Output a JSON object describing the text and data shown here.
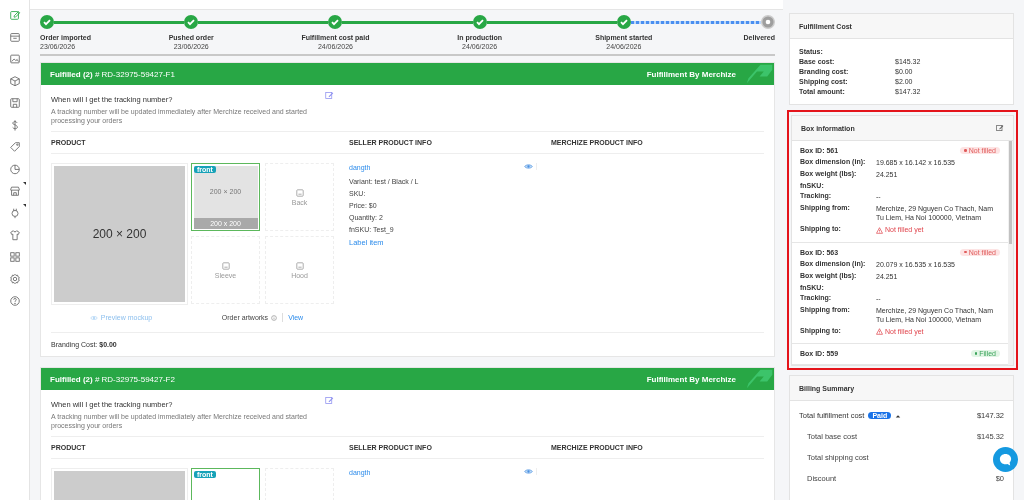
{
  "sidebar": {
    "items": [
      {
        "selected": true,
        "expandable": false
      },
      {
        "selected": false,
        "expandable": false
      },
      {
        "selected": false,
        "expandable": false
      },
      {
        "selected": false,
        "expandable": false
      },
      {
        "selected": false,
        "expandable": false
      },
      {
        "selected": false,
        "expandable": false
      },
      {
        "selected": false,
        "expandable": false
      },
      {
        "selected": false,
        "expandable": false
      },
      {
        "selected": false,
        "expandable": true
      },
      {
        "selected": false,
        "expandable": true
      },
      {
        "selected": false,
        "expandable": false
      },
      {
        "selected": false,
        "expandable": false
      },
      {
        "selected": false,
        "expandable": false
      },
      {
        "selected": false,
        "expandable": false
      }
    ]
  },
  "progress": {
    "steps": [
      {
        "label": "Order imported",
        "date": "23/06/2026",
        "done": true
      },
      {
        "label": "Pushed order",
        "date": "23/06/2026",
        "done": true
      },
      {
        "label": "Fulfillment cost paid",
        "date": "24/06/2026",
        "done": true
      },
      {
        "label": "In production",
        "date": "24/06/2026",
        "done": true
      },
      {
        "label": "Shipment started",
        "date": "24/06/2026",
        "done": true
      },
      {
        "label": "Delivered",
        "done": false
      }
    ]
  },
  "orders": [
    {
      "status": "Fulfilled (2)",
      "code": "# RD-32975-59427-F1",
      "fulfiller": "Fulfillment By Merchize",
      "tracking_question": "When will I get the tracking number?",
      "tracking_note": "A tracking number will be updated immediately after Merchize received and started processing your orders",
      "columns": [
        "PRODUCT",
        "SELLER PRODUCT INFO",
        "MERCHIZE PRODUCT INFO"
      ],
      "mockup": "200 × 200",
      "artworks": [
        {
          "badge": "front",
          "image": "200 × 200",
          "caption": "200 x 200",
          "selected": true
        },
        {
          "label": "Back",
          "selected": false
        },
        {
          "label": "Sleeve",
          "selected": false
        },
        {
          "label": "Hood",
          "selected": false
        }
      ],
      "preview": "Preview mockup",
      "artworks_label": "Order artworks",
      "view": "View",
      "seller": {
        "name": "dangth",
        "details": [
          "Variant: test / Black / L",
          "SKU:",
          "Price: $0",
          "Quantity: 2",
          "fnSKU: Test_9"
        ],
        "label_link": "Label item"
      },
      "branding_label": "Branding Cost:",
      "branding_value": "$0.00"
    },
    {
      "status": "Fulfilled (2)",
      "code": "# RD-32975-59427-F2",
      "fulfiller": "Fulfillment By Merchize",
      "tracking_question": "When will I get the tracking number?",
      "tracking_note": "A tracking number will be updated immediately after Merchize received and started processing your orders",
      "columns": [
        "PRODUCT",
        "SELLER PRODUCT INFO",
        "MERCHIZE PRODUCT INFO"
      ],
      "artworks": [
        {
          "badge": "front",
          "selected": true
        },
        {
          "selected": false
        }
      ],
      "seller": {
        "name": "dangth"
      }
    }
  ],
  "fulfillment_cost": {
    "title": "Fulfillment Cost",
    "rows": [
      {
        "label": "Status:"
      },
      {
        "label": "Base cost:",
        "value": "$145.32"
      },
      {
        "label": "Branding cost:",
        "value": "$0.00"
      },
      {
        "label": "Shipping cost:",
        "value": "$2.00"
      },
      {
        "label": "Total amount:",
        "value": "$147.32"
      }
    ]
  },
  "box_information": {
    "title": "Box information",
    "highlighted": true,
    "boxes": [
      {
        "id_label": "Box ID: 561",
        "status": "Not filled",
        "filled": false,
        "fields": [
          {
            "label": "Box dimension (in):",
            "value": "19.685 x 16.142 x 16.535",
            "kind": "text"
          },
          {
            "label": "Box weight (lbs):",
            "value": "24.251",
            "kind": "text"
          },
          {
            "label": "fnSKU:",
            "kind": "text"
          },
          {
            "label": "Tracking:",
            "value": "--",
            "kind": "text"
          },
          {
            "label": "Shipping from:",
            "value": "Merchize, 29 Nguyen Co Thach, Nam Tu Liem, Ha Noi 100000, Vietnam",
            "kind": "text"
          },
          {
            "label": "Shipping to:",
            "value": "Not filled yet",
            "kind": "warning"
          }
        ]
      },
      {
        "id_label": "Box ID: 563",
        "status": "Not filled",
        "filled": false,
        "fields": [
          {
            "label": "Box dimension (in):",
            "value": "20.079 x 16.535 x 16.535",
            "kind": "text"
          },
          {
            "label": "Box weight (lbs):",
            "value": "24.251",
            "kind": "text"
          },
          {
            "label": "fnSKU:",
            "kind": "text"
          },
          {
            "label": "Tracking:",
            "value": "--",
            "kind": "text"
          },
          {
            "label": "Shipping from:",
            "value": "Merchize, 29 Nguyen Co Thach, Nam Tu Liem, Ha Noi 100000, Vietnam",
            "kind": "text"
          },
          {
            "label": "Shipping to:",
            "value": "Not filled yet",
            "kind": "warning"
          }
        ]
      },
      {
        "id_label": "Box ID: 559",
        "status": "Filled",
        "filled": true
      }
    ]
  },
  "billing_summary": {
    "title": "Billing Summary",
    "total": {
      "label": "Total fulfillment cost",
      "badge": "Paid",
      "expanded": true,
      "value": "$147.32"
    },
    "rows": [
      {
        "label": "Total base cost",
        "value": "$145.32"
      },
      {
        "label": "Total shipping cost"
      },
      {
        "label": "Discount",
        "value": "$0"
      }
    ]
  }
}
